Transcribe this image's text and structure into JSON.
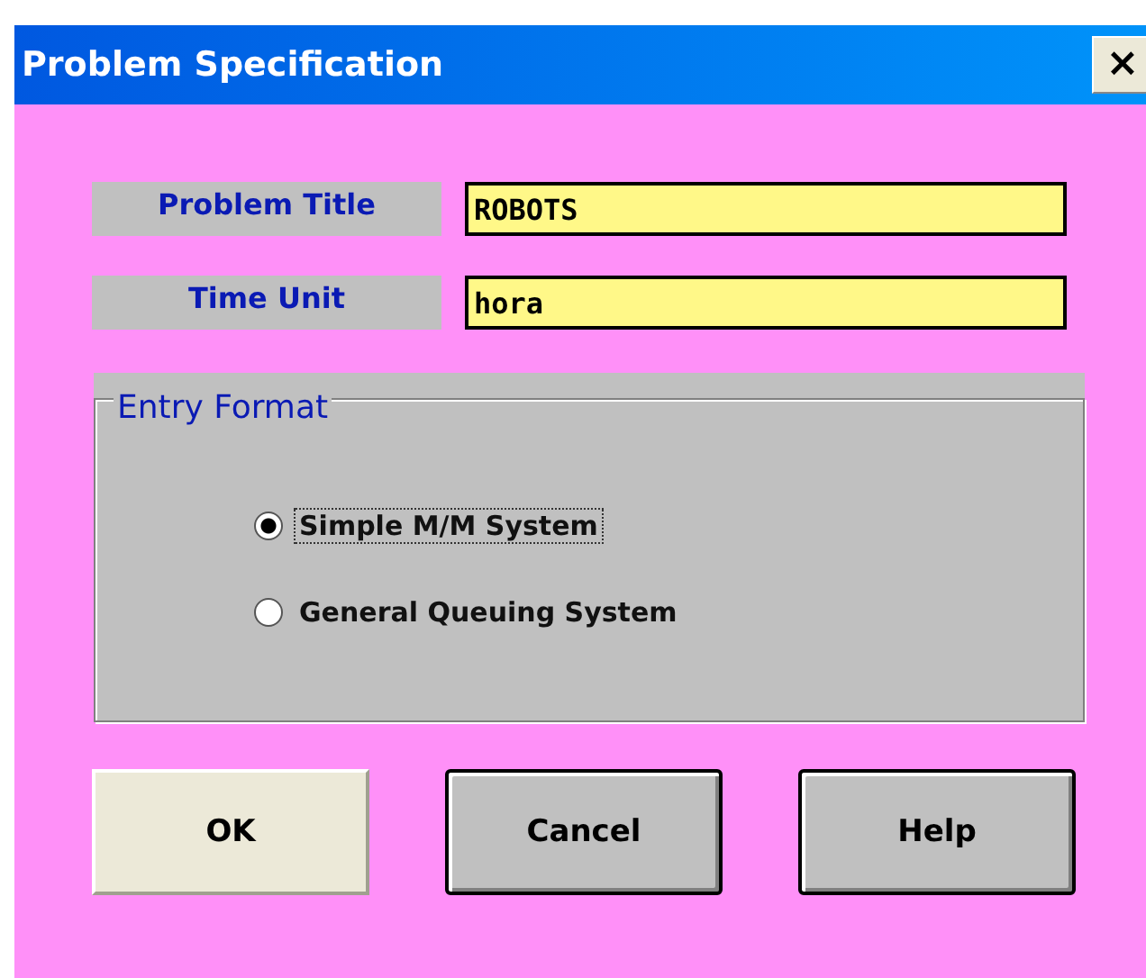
{
  "window": {
    "title": "Problem Specification",
    "close": "×"
  },
  "fields": [
    {
      "label": "Problem Title",
      "value": "ROBOTS"
    },
    {
      "label": "Time Unit",
      "value": "hora"
    }
  ],
  "entry_format": {
    "legend": "Entry Format",
    "options": [
      {
        "label": "Simple M/M System",
        "selected": true
      },
      {
        "label": "General Queuing System",
        "selected": false
      }
    ]
  },
  "buttons": [
    {
      "label": "OK",
      "kind": "plain"
    },
    {
      "label": "Cancel",
      "kind": "framed"
    },
    {
      "label": "Help",
      "kind": "framed"
    }
  ]
}
